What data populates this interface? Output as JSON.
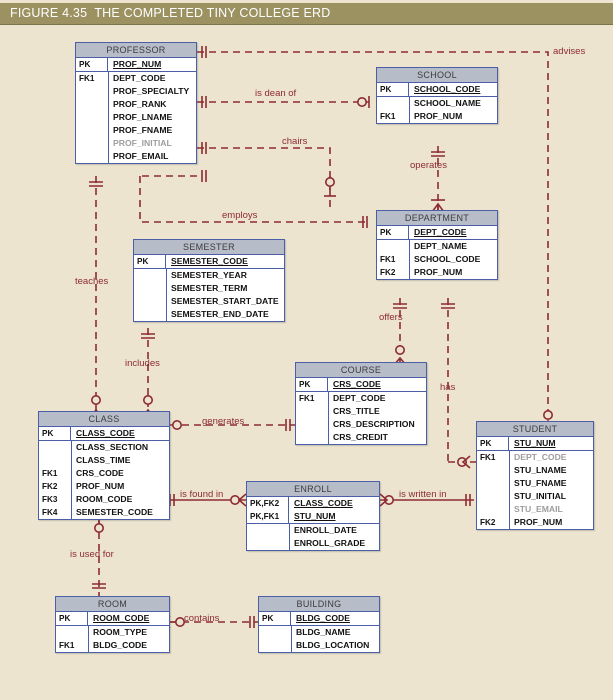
{
  "figure": {
    "title": "FIGURE 4.35  THE COMPLETED TINY COLLEGE ERD",
    "header_color": "#9c9261",
    "canvas_color": "#ece4cf",
    "entity_border_color": "#4a5fa8",
    "entity_header_color": "#b6bcc8",
    "relationship_color": "#8d2b32"
  },
  "entities": [
    {
      "name": "PROFESSOR",
      "keys": [
        {
          "key": "PK",
          "attr": "PROF_NUM"
        }
      ],
      "attributes": [
        {
          "key": "FK1",
          "attr": "DEPT_CODE",
          "faded": false
        },
        {
          "key": "",
          "attr": "PROF_SPECIALTY",
          "faded": false
        },
        {
          "key": "",
          "attr": "PROF_RANK",
          "faded": false
        },
        {
          "key": "",
          "attr": "PROF_LNAME",
          "faded": false
        },
        {
          "key": "",
          "attr": "PROF_FNAME",
          "faded": false
        },
        {
          "key": "",
          "attr": "PROF_INITIAL",
          "faded": true
        },
        {
          "key": "",
          "attr": "PROF_EMAIL",
          "faded": false
        }
      ]
    },
    {
      "name": "SCHOOL",
      "keys": [
        {
          "key": "PK",
          "attr": "SCHOOL_CODE"
        }
      ],
      "attributes": [
        {
          "key": "",
          "attr": "SCHOOL_NAME",
          "faded": false
        },
        {
          "key": "FK1",
          "attr": "PROF_NUM",
          "faded": false
        }
      ]
    },
    {
      "name": "DEPARTMENT",
      "keys": [
        {
          "key": "PK",
          "attr": "DEPT_CODE"
        }
      ],
      "attributes": [
        {
          "key": "",
          "attr": "DEPT_NAME",
          "faded": false
        },
        {
          "key": "FK1",
          "attr": "SCHOOL_CODE",
          "faded": false
        },
        {
          "key": "FK2",
          "attr": "PROF_NUM",
          "faded": false
        }
      ]
    },
    {
      "name": "SEMESTER",
      "keys": [
        {
          "key": "PK",
          "attr": "SEMESTER_CODE"
        }
      ],
      "attributes": [
        {
          "key": "",
          "attr": "SEMESTER_YEAR",
          "faded": false
        },
        {
          "key": "",
          "attr": "SEMESTER_TERM",
          "faded": false
        },
        {
          "key": "",
          "attr": "SEMESTER_START_DATE",
          "faded": false
        },
        {
          "key": "",
          "attr": "SEMESTER_END_DATE",
          "faded": false
        }
      ]
    },
    {
      "name": "COURSE",
      "keys": [
        {
          "key": "PK",
          "attr": "CRS_CODE"
        }
      ],
      "attributes": [
        {
          "key": "FK1",
          "attr": "DEPT_CODE",
          "faded": false
        },
        {
          "key": "",
          "attr": "CRS_TITLE",
          "faded": false
        },
        {
          "key": "",
          "attr": "CRS_DESCRIPTION",
          "faded": false
        },
        {
          "key": "",
          "attr": "CRS_CREDIT",
          "faded": false
        }
      ]
    },
    {
      "name": "CLASS",
      "keys": [
        {
          "key": "PK",
          "attr": "CLASS_CODE"
        }
      ],
      "attributes": [
        {
          "key": "",
          "attr": "CLASS_SECTION",
          "faded": false
        },
        {
          "key": "",
          "attr": "CLASS_TIME",
          "faded": false
        },
        {
          "key": "FK1",
          "attr": "CRS_CODE",
          "faded": false
        },
        {
          "key": "FK2",
          "attr": "PROF_NUM",
          "faded": false
        },
        {
          "key": "FK3",
          "attr": "ROOM_CODE",
          "faded": false
        },
        {
          "key": "FK4",
          "attr": "SEMESTER_CODE",
          "faded": false
        }
      ]
    },
    {
      "name": "ENROLL",
      "keys": [
        {
          "key": "PK,FK2",
          "attr": "CLASS_CODE"
        },
        {
          "key": "PK,FK1",
          "attr": "STU_NUM"
        }
      ],
      "attributes": [
        {
          "key": "",
          "attr": "ENROLL_DATE",
          "faded": false
        },
        {
          "key": "",
          "attr": "ENROLL_GRADE",
          "faded": false
        }
      ]
    },
    {
      "name": "STUDENT",
      "keys": [
        {
          "key": "PK",
          "attr": "STU_NUM"
        }
      ],
      "attributes": [
        {
          "key": "FK1",
          "attr": "DEPT_CODE",
          "faded": true
        },
        {
          "key": "",
          "attr": "STU_LNAME",
          "faded": false
        },
        {
          "key": "",
          "attr": "STU_FNAME",
          "faded": false
        },
        {
          "key": "",
          "attr": "STU_INITIAL",
          "faded": false
        },
        {
          "key": "",
          "attr": "STU_EMAIL",
          "faded": true
        },
        {
          "key": "FK2",
          "attr": "PROF_NUM",
          "faded": false
        }
      ]
    },
    {
      "name": "ROOM",
      "keys": [
        {
          "key": "PK",
          "attr": "ROOM_CODE"
        }
      ],
      "attributes": [
        {
          "key": "",
          "attr": "ROOM_TYPE",
          "faded": false
        },
        {
          "key": "FK1",
          "attr": "BLDG_CODE",
          "faded": false
        }
      ]
    },
    {
      "name": "BUILDING",
      "keys": [
        {
          "key": "PK",
          "attr": "BLDG_CODE"
        }
      ],
      "attributes": [
        {
          "key": "",
          "attr": "BLDG_NAME",
          "faded": false
        },
        {
          "key": "",
          "attr": "BLDG_LOCATION",
          "faded": false
        }
      ]
    }
  ],
  "relationships": [
    {
      "label": "is dean of",
      "from": "PROFESSOR",
      "to": "SCHOOL",
      "style": "dashed"
    },
    {
      "label": "advises",
      "from": "PROFESSOR",
      "to": "STUDENT",
      "style": "dashed"
    },
    {
      "label": "chairs",
      "from": "PROFESSOR",
      "to": "DEPARTMENT",
      "style": "dashed"
    },
    {
      "label": "employs",
      "from": "PROFESSOR",
      "to": "DEPARTMENT",
      "style": "dashed"
    },
    {
      "label": "operates",
      "from": "SCHOOL",
      "to": "DEPARTMENT",
      "style": "dashed"
    },
    {
      "label": "teaches",
      "from": "PROFESSOR",
      "to": "CLASS",
      "style": "dashed"
    },
    {
      "label": "includes",
      "from": "SEMESTER",
      "to": "CLASS",
      "style": "dashed"
    },
    {
      "label": "offers",
      "from": "DEPARTMENT",
      "to": "COURSE",
      "style": "dashed"
    },
    {
      "label": "has",
      "from": "DEPARTMENT",
      "to": "STUDENT",
      "style": "dashed"
    },
    {
      "label": "generates",
      "from": "COURSE",
      "to": "CLASS",
      "style": "dashed"
    },
    {
      "label": "is found in",
      "from": "CLASS",
      "to": "ENROLL",
      "style": "solid"
    },
    {
      "label": "is written in",
      "from": "ENROLL",
      "to": "STUDENT",
      "style": "solid"
    },
    {
      "label": "is used for",
      "from": "CLASS",
      "to": "ROOM",
      "style": "dashed"
    },
    {
      "label": "contains",
      "from": "BUILDING",
      "to": "ROOM",
      "style": "dashed"
    }
  ]
}
